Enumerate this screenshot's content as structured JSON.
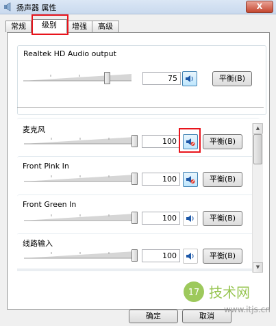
{
  "window": {
    "title": "扬声器 属性",
    "close_glyph": "X"
  },
  "tabs": [
    {
      "label": "常规",
      "active": false
    },
    {
      "label": "级别",
      "active": true
    },
    {
      "label": "增强",
      "active": false
    },
    {
      "label": "高级",
      "active": false
    }
  ],
  "main_output": {
    "label": "Realtek HD Audio output",
    "level": 75,
    "value": "75",
    "balance_label": "平衡(B)"
  },
  "inputs": [
    {
      "label": "麦克风",
      "level": 100,
      "value": "100",
      "muted": true,
      "balance_label": "平衡(B)"
    },
    {
      "label": "Front Pink In",
      "level": 100,
      "value": "100",
      "muted": true,
      "balance_label": "平衡(B)"
    },
    {
      "label": "Front Green In",
      "level": 100,
      "value": "100",
      "muted": false,
      "balance_label": "平衡(B)"
    },
    {
      "label": "线路输入",
      "level": 100,
      "value": "100",
      "muted": false,
      "balance_label": "平衡(B)"
    }
  ],
  "buttons": {
    "ok": "确定",
    "cancel": "取消"
  },
  "watermark": {
    "number": "17",
    "name": "技术网",
    "url": "www.itjs.cn"
  }
}
